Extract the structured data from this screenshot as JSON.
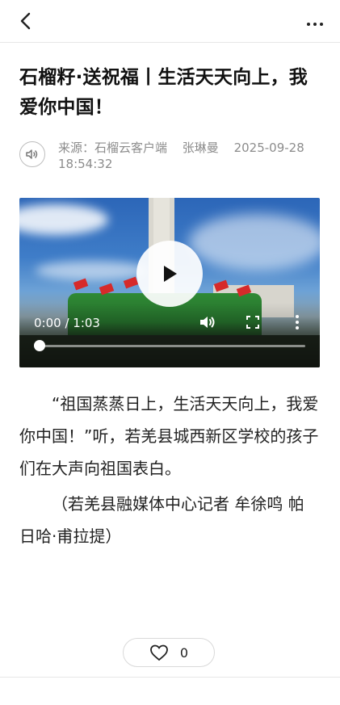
{
  "header": {
    "back_icon": "chevron-left-icon",
    "more_icon": "more-horizontal-icon"
  },
  "article": {
    "title": "石榴籽·送祝福丨生活天天向上，我爱你中国！",
    "meta": {
      "source": "来源：石榴云客户端",
      "author": "张琳曼",
      "date": "2025-09-28",
      "time": "18:54:32",
      "speaker_icon": "speaker-icon"
    },
    "video": {
      "current_time": "0:00",
      "duration": "1:03",
      "time_text": "0:00 / 1:03",
      "progress_fraction": 0.0
    },
    "paragraphs": [
      "“祖国蒸蒸日上，生活天天向上，我爱你中国！”听，若羌县城西新区学校的孩子们在大声向祖国表白。",
      "（若羌县融媒体中心记者 牟徐鸣 帕日哈·甫拉提）"
    ]
  },
  "like": {
    "icon": "heart-icon",
    "count": "0"
  },
  "colors": {
    "text": "#111111",
    "meta": "#8c8c8c",
    "divider": "#e6e6e6"
  }
}
